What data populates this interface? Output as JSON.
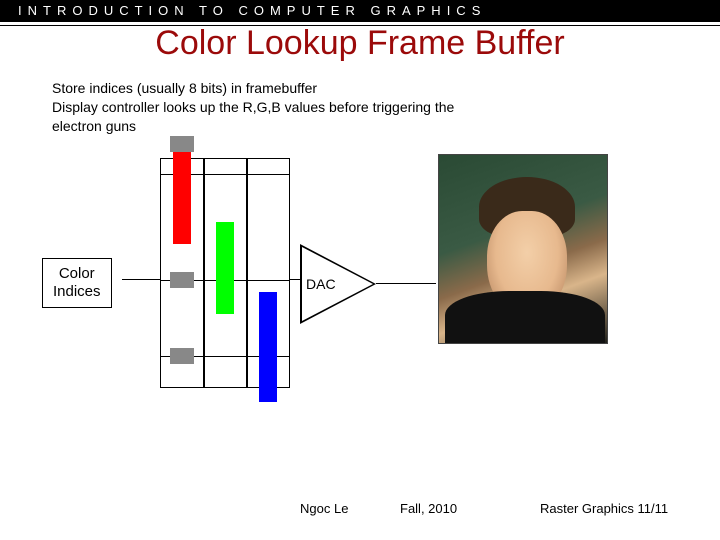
{
  "header": {
    "text": "INTRODUCTION TO COMPUTER GRAPHICS"
  },
  "title": "Color Lookup Frame Buffer",
  "body": {
    "line1": "Store indices (usually 8 bits) in framebuffer",
    "line2": "Display controller looks up the R,G,B values before triggering the electron guns"
  },
  "labels": {
    "color_indices_l1": "Color",
    "color_indices_l2": "Indices",
    "dac": "DAC"
  },
  "footer": {
    "author": "Ngoc Le",
    "term": "Fall, 2010",
    "section": "Raster Graphics 11/11"
  }
}
